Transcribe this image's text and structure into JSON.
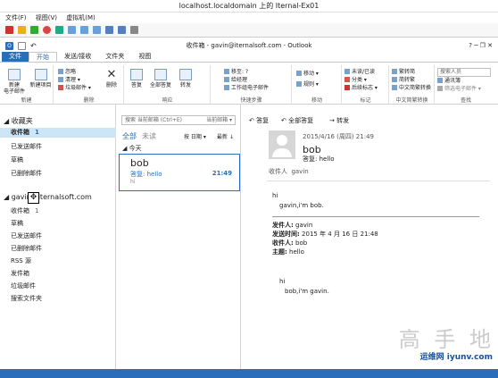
{
  "vm": {
    "title": "localhost.localdomain 上的 Iternal-Ex01",
    "menu": [
      "文件(F)",
      "视图(V)",
      "虚拟机(M)"
    ]
  },
  "outlook": {
    "window_title": "收件箱 - gavin@iternalsoft.com - Outlook",
    "window_controls": "? ─ ❐ ✕"
  },
  "tabs": [
    "文件",
    "开始",
    "发送/接收",
    "文件夹",
    "视图"
  ],
  "ribbon": {
    "new_email": "新建\n电子邮件",
    "new_items": "新建项目",
    "group_new": "新建",
    "ignore": "忽略",
    "cleanup": "清理 ▾",
    "junk": "垃圾邮件 ▾",
    "delete": "删除",
    "group_delete": "删除",
    "reply": "答复",
    "reply_all": "全部答复",
    "forward": "转发",
    "group_respond": "响应",
    "qs1": "移至: ?",
    "qs2": "给经理",
    "qs3": "工作组电子邮件",
    "group_quicksteps": "快速步骤",
    "move": "移动 ▾",
    "rules": "规则 ▾",
    "group_move": "移动",
    "unread": "未读/已读",
    "categorize": "分类 ▾",
    "followup": "后续标志 ▾",
    "group_tags": "标记",
    "trad": "繁转简",
    "simp": "简转繁",
    "conv": "中文简繁转换",
    "group_chinese": "中文简繁转换",
    "search_people": "搜索人员",
    "address_book": "通讯簿",
    "filter_email": "筛选电子邮件 ▾",
    "group_find": "查找"
  },
  "left": {
    "favorites": "◢ 收藏夹",
    "fav_items": [
      {
        "label": "收件箱",
        "count": "1"
      },
      {
        "label": "已发送邮件"
      },
      {
        "label": "草稿"
      },
      {
        "label": "已删除邮件"
      }
    ],
    "account": "◢ gavin@iternalsoft.com",
    "acc_items": [
      {
        "label": "收件箱",
        "count": "1"
      },
      {
        "label": "草稿"
      },
      {
        "label": "已发送邮件"
      },
      {
        "label": "已删除邮件"
      },
      {
        "label": "RSS 源"
      },
      {
        "label": "发件箱"
      },
      {
        "label": "垃圾邮件"
      },
      {
        "label": "搜索文件夹"
      }
    ]
  },
  "mid": {
    "search_placeholder": "搜索 当前邮箱 (Ctrl+E)",
    "scope": "当前邮箱 ▾",
    "filter_all": "全部",
    "filter_unread": "未读",
    "sort": "按 日期 ▾",
    "order": "最新 ↓",
    "group_today": "◢ 今天",
    "msg": {
      "sender": "bob",
      "subject": "答复: hello",
      "time": "21:49",
      "preview": "hi"
    }
  },
  "read": {
    "reply": "答复",
    "reply_all": "全部答复",
    "forward": "转发",
    "date": "2015/4/16 (周四) 21:49",
    "sender": "bob",
    "subject": "答复: hello",
    "to_label": "收件人",
    "to": "gavin",
    "body1": "hi",
    "body2": "gavin,i'm bob.",
    "from_label": "发件人:",
    "from": "gavin",
    "sent_label": "发送时间:",
    "sent": "2015 年 4 月 16 日 21:48",
    "recv_label": "收件人:",
    "recv": "bob",
    "subj_label": "主题:",
    "subj": "hello",
    "body3": "hi",
    "body4": "bob,i'm gavin."
  },
  "watermark": {
    "big": "高 手 地",
    "small": "iyunv.com",
    "brand": "运维网"
  }
}
